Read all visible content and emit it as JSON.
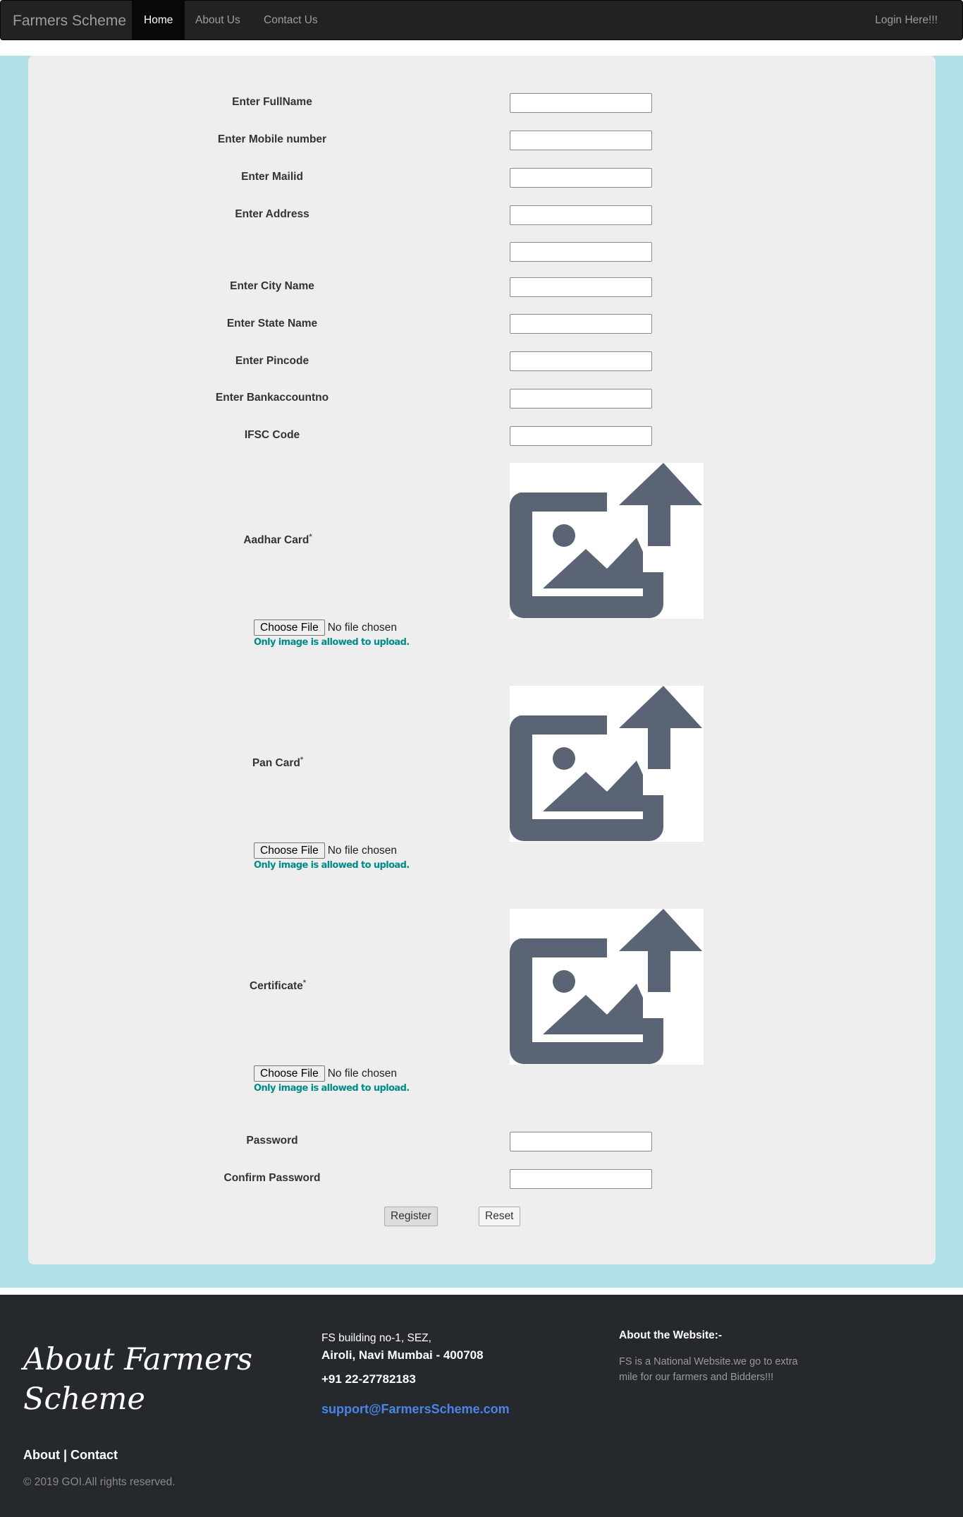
{
  "nav": {
    "brand": "Farmers Scheme",
    "home": "Home",
    "about": "About Us",
    "contact": "Contact Us",
    "login": "Login Here!!!"
  },
  "form": {
    "fullname_label": "Enter FullName",
    "mobile_label": "Enter Mobile number",
    "mail_label": "Enter Mailid",
    "address_label": "Enter Address",
    "city_label": "Enter City Name",
    "state_label": "Enter State Name",
    "pincode_label": "Enter Pincode",
    "bank_label": "Enter Bankaccountno",
    "ifsc_label": "IFSC Code",
    "aadhar_label": "Aadhar Card",
    "pan_label": "Pan Card",
    "certificate_label": "Certificate",
    "required_mark": "*",
    "choose_file": "Choose File",
    "no_file": "No file chosen",
    "upload_hint": "Only image is allowed to upload.",
    "password_label": "Password",
    "confirm_password_label": "Confirm Password",
    "register": "Register",
    "reset": "Reset"
  },
  "footer": {
    "title": "About Farmers Scheme",
    "address_line1": "FS building no-1, SEZ,",
    "address_line2": "Airoli, Navi Mumbai - 400708",
    "phone": "+91 22-27782183",
    "email": "support@FarmersScheme.com",
    "about_heading": "About the Website:-",
    "about_text": "FS is a National Website.we go to extra mile for our farmers and Bidders!!!",
    "links": "About | Contact",
    "copyright": "© 2019 GOI.All rights reserved."
  },
  "colors": {
    "band": "#b0e0e6",
    "panel": "#eeeeee",
    "hint": "#008b8b",
    "email": "#4a86e8",
    "icon": "#5b6474"
  }
}
